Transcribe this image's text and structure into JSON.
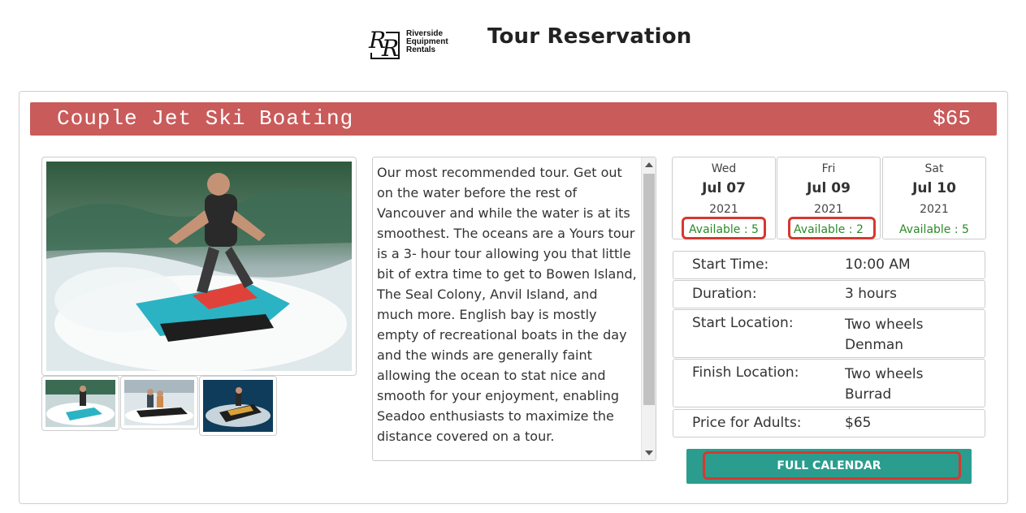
{
  "header": {
    "logo_text": [
      "Riverside",
      "Equipment",
      "Rentals"
    ],
    "logo_monogram": "RR",
    "title": "Tour Reservation"
  },
  "tour": {
    "name": "Couple Jet Ski Boating",
    "price": "$65",
    "bar_color": "#c95b5b",
    "description": "Our most recommended tour. Get out on the water before the rest of Vancouver and while the water is at its smoothest. The oceans are a Yours tour is a 3- hour tour allowing you that little bit of extra time to get to Bowen Island, The Seal Colony, Anvil Island, and much more. English bay is mostly empty of recreational boats in the day and the winds are generally faint allowing the ocean to stat nice and smooth for your enjoyment, enabling Seadoo enthusiasts to maximize the distance covered on a tour."
  },
  "dates": [
    {
      "day": "Wed",
      "date": "Jul 07",
      "year": "2021",
      "availability": "Available : 5",
      "highlighted": true
    },
    {
      "day": "Fri",
      "date": "Jul 09",
      "year": "2021",
      "availability": "Available : 2",
      "highlighted": true
    },
    {
      "day": "Sat",
      "date": "Jul 10",
      "year": "2021",
      "availability": "Available : 5",
      "highlighted": false
    }
  ],
  "details": [
    {
      "label": "Start Time:",
      "value": "10:00 AM"
    },
    {
      "label": "Duration:",
      "value": "3 hours"
    },
    {
      "label": "Start Location:",
      "value": "Two wheels Denman"
    },
    {
      "label": "Finish Location:",
      "value": "Two wheels Burrad"
    },
    {
      "label": "Price for Adults:",
      "value": "$65"
    }
  ],
  "full_calendar_label": "FULL CALENDAR",
  "colors": {
    "accent": "#2a9d8f",
    "available": "#2a8a2a",
    "highlight": "#d7382e"
  }
}
